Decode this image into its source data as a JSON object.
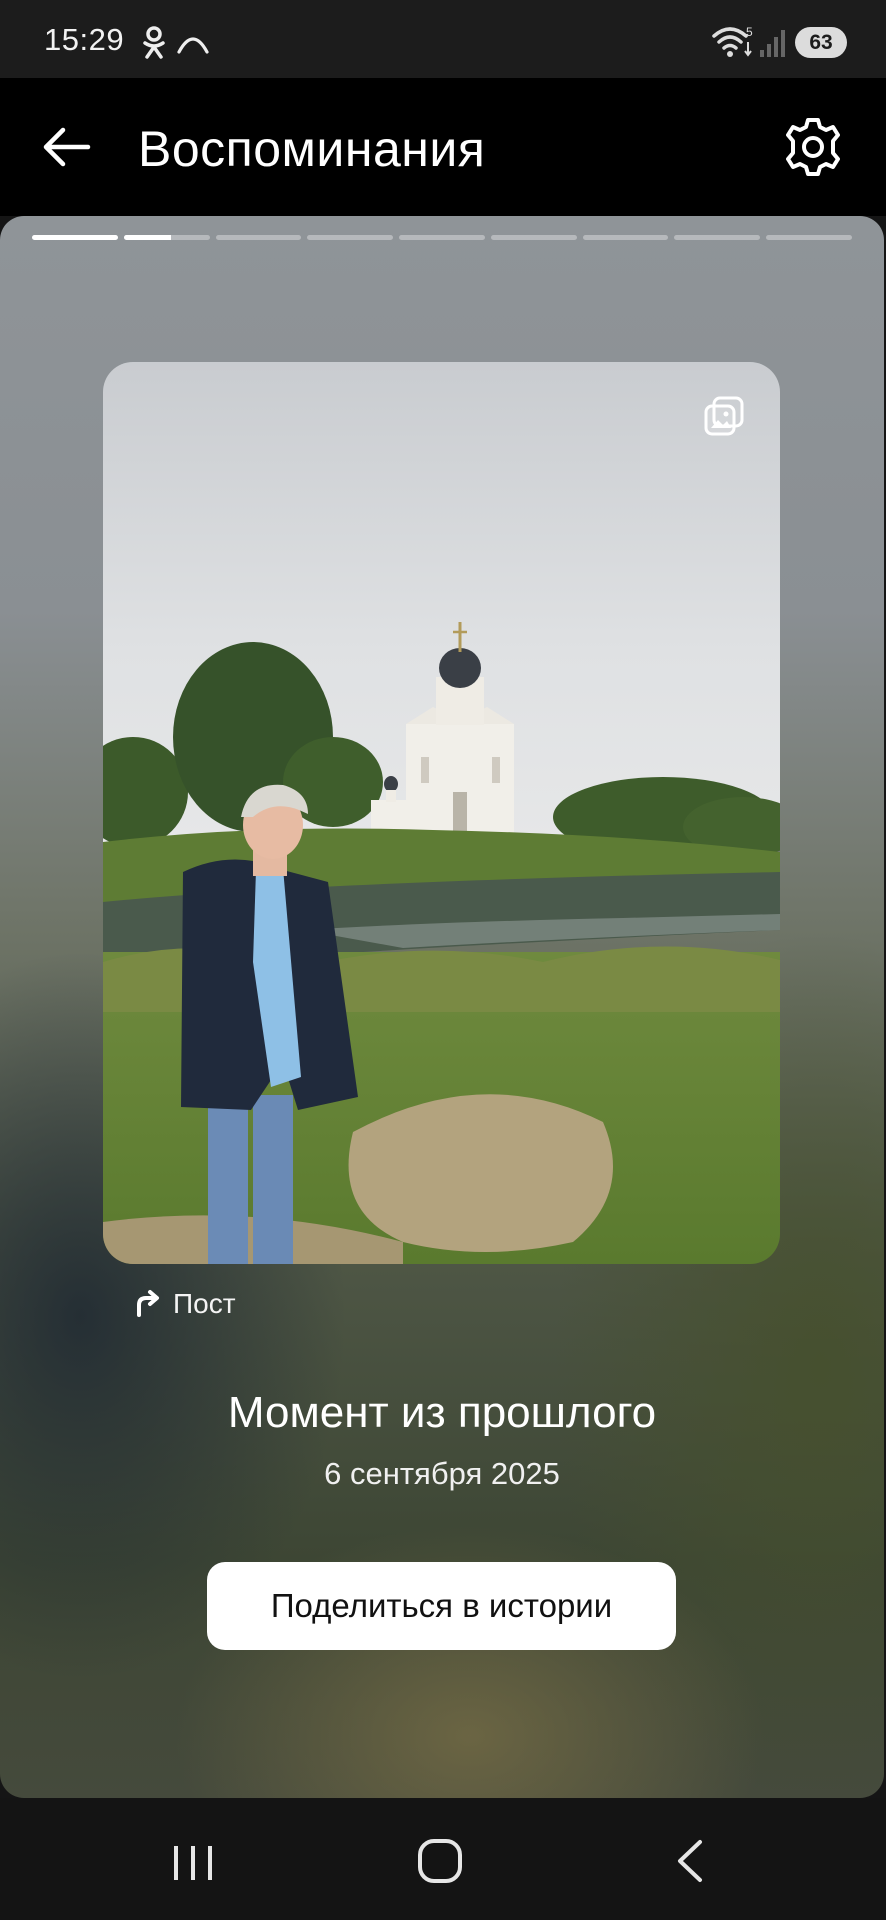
{
  "status_bar": {
    "time": "15:29",
    "battery": "63",
    "icons": [
      "ok-icon",
      "arc-icon",
      "wifi-icon",
      "signal-icon"
    ]
  },
  "header": {
    "title": "Воспоминания",
    "back_icon": "arrow-left-icon",
    "settings_icon": "gear-icon"
  },
  "memory": {
    "progress_segments": [
      {
        "state": "done",
        "fill": 1.0
      },
      {
        "state": "current",
        "fill": 0.55
      },
      {
        "state": "pending",
        "fill": 0
      },
      {
        "state": "pending",
        "fill": 0
      },
      {
        "state": "pending",
        "fill": 0
      },
      {
        "state": "pending",
        "fill": 0
      },
      {
        "state": "pending",
        "fill": 0
      },
      {
        "state": "pending",
        "fill": 0
      },
      {
        "state": "pending",
        "fill": 0
      }
    ],
    "photo_badge_icon": "gallery-icon",
    "source_icon": "repost-icon",
    "source_label": "Пост",
    "title": "Момент из прошлого",
    "date": "6 сентября 2025",
    "share_label": "Поделиться в истории"
  },
  "nav_bar": {
    "recent_icon": "recent-apps-icon",
    "home_icon": "home-icon",
    "back_icon": "back-chevron-icon"
  }
}
